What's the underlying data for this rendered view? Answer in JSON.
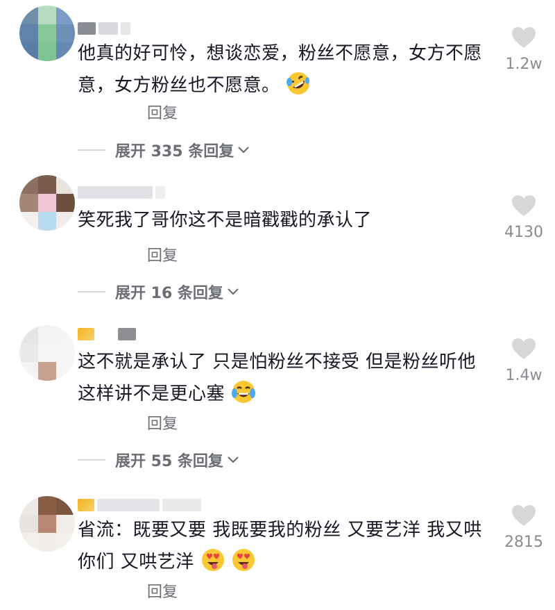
{
  "comments": [
    {
      "text": "他真的好可怜，想谈恋爱，粉丝不愿意，女方不愿意，女方粉丝也不愿意。",
      "emoji": "rolling-on-floor-laughing-emoji",
      "reply_label": "回复",
      "expand_label": "展开 335 条回复",
      "like_count": "1.2w"
    },
    {
      "text": "笑死我了哥你这不是暗戳戳的承认了",
      "reply_label": "回复",
      "expand_label": "展开 16 条回复",
      "like_count": "4130"
    },
    {
      "text": "这不就是承认了 只是怕粉丝不接受 但是粉丝听他这样讲不是更心塞",
      "emoji": "crying-laughing-emoji",
      "reply_label": "回复",
      "expand_label": "展开 55 条回复",
      "like_count": "1.4w"
    },
    {
      "text": "省流：既要又要 我既要我的粉丝 又要艺洋 我又哄你们 又哄艺洋",
      "emoji": "heart-eyes-tongue-emoji",
      "reply_label": "回复",
      "like_count": "2815"
    }
  ],
  "colors": {
    "text": "#161823",
    "secondary": "#6b6e74",
    "heart": "#d6d7d9"
  }
}
